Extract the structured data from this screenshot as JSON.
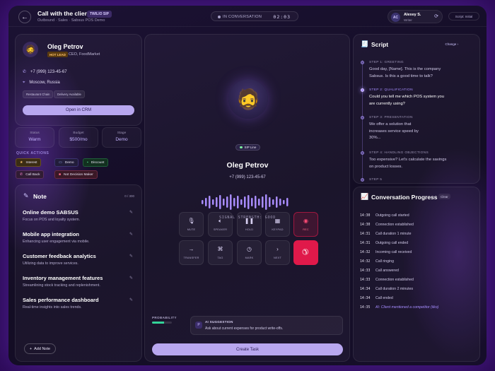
{
  "header": {
    "title": "Call with the client",
    "badge": "TWILIO SIP",
    "subtitle": "Outbound · Sales · Sabsus POS Demo",
    "call_status": "IN CONVERSATION",
    "timer": "02:03",
    "user_initials": "AC",
    "user_name": "Alexey S.",
    "user_role": "Writer",
    "script_chip": "Script: Initial"
  },
  "contact": {
    "name": "Oleg Petrov",
    "lead_badge": "HOT LEAD",
    "role": "CEO, FoodMarket",
    "phone": "+7 (999) 123-45-67",
    "location": "Moscow, Russia",
    "tags": [
      "Restaurant Chain",
      "Delivery Available"
    ],
    "open_crm": "Open in CRM"
  },
  "stats": [
    {
      "label": "Status",
      "value": "Warm"
    },
    {
      "label": "Budget",
      "value": "$500/mo"
    },
    {
      "label": "Stage",
      "value": "Demo"
    }
  ],
  "quick_actions": {
    "title": "QUICK ACTIONS",
    "items": [
      "Interest",
      "Demo",
      "Discount",
      "Call Back",
      "Not Decision Maker"
    ]
  },
  "note": {
    "title": "Note",
    "count": "0 / 300",
    "items": [
      {
        "title": "Online demo SABSUS",
        "sub": "Focus on POS and loyalty system."
      },
      {
        "title": "Mobile app integration",
        "sub": "Enhancing user engagement via mobile."
      },
      {
        "title": "Customer feedback analytics",
        "sub": "Utilizing data to improve services."
      },
      {
        "title": "Inventory management features",
        "sub": "Streamlining stock tracking and replenishment."
      },
      {
        "title": "Sales performance dashboard",
        "sub": "Real-time insights into sales trends."
      }
    ],
    "add_label": "Add Note"
  },
  "center": {
    "sip_label": "SIP Line",
    "name": "Oleg Petrov",
    "phone": "+7 (999) 123-45-67",
    "signal": "SIGNAL STRENGTH: GOOD",
    "controls": [
      "MUTE",
      "SPEAKER",
      "HOLD",
      "KEYPAD",
      "REC",
      "TRANSFER",
      "TAG",
      "MARK",
      "NEXT"
    ],
    "probability_label": "PROBABILITY",
    "probability": 0.6,
    "ai_title": "AI SUGGESTION",
    "ai_text": "Ask about current expenses for product write-offs.",
    "create_task": "Create Task"
  },
  "script": {
    "title": "Script",
    "change": "Change",
    "steps": [
      {
        "head": "STEP 1: GREETING",
        "lines": [
          "Good day, [Name]. This is the company",
          "Sabsus. Is this a good time to talk?"
        ]
      },
      {
        "head": "STEP 2: QUALIFICATION",
        "lines": [
          "Could you tell me which POS system you",
          "are currently using?"
        ]
      },
      {
        "head": "STEP 3: PRESENTATION",
        "lines": [
          "We offer a solution that",
          "increases service speed by",
          "30%..."
        ]
      },
      {
        "head": "STEP 4: HANDLING OBJECTIONS",
        "lines": [
          "Too expensive? Let's calculate the savings",
          "on product losses."
        ]
      },
      {
        "head": "STEP 5",
        "lines": []
      }
    ]
  },
  "progress": {
    "title": "Conversation Progress",
    "clear": "Clear",
    "log": [
      {
        "time": "14:30",
        "text": "Outgoing call started"
      },
      {
        "time": "14:30",
        "text": "Connection established"
      },
      {
        "time": "14:31",
        "text": "Call duration 1 minute"
      },
      {
        "time": "14:31",
        "text": "Outgoing call ended"
      },
      {
        "time": "14:32",
        "text": "Incoming call received"
      },
      {
        "time": "14:32",
        "text": "Call ringing"
      },
      {
        "time": "14:33",
        "text": "Call answered"
      },
      {
        "time": "14:33",
        "text": "Connection established"
      },
      {
        "time": "14:34",
        "text": "Call duration 2 minutes"
      },
      {
        "time": "14:34",
        "text": "Call ended"
      },
      {
        "time": "14:35",
        "text": "AI: Client mentioned a competitor (iiko)"
      }
    ]
  },
  "colors": {
    "accent": "#b8a7ef",
    "rec": "#e0194a",
    "active": "#a68cff"
  }
}
